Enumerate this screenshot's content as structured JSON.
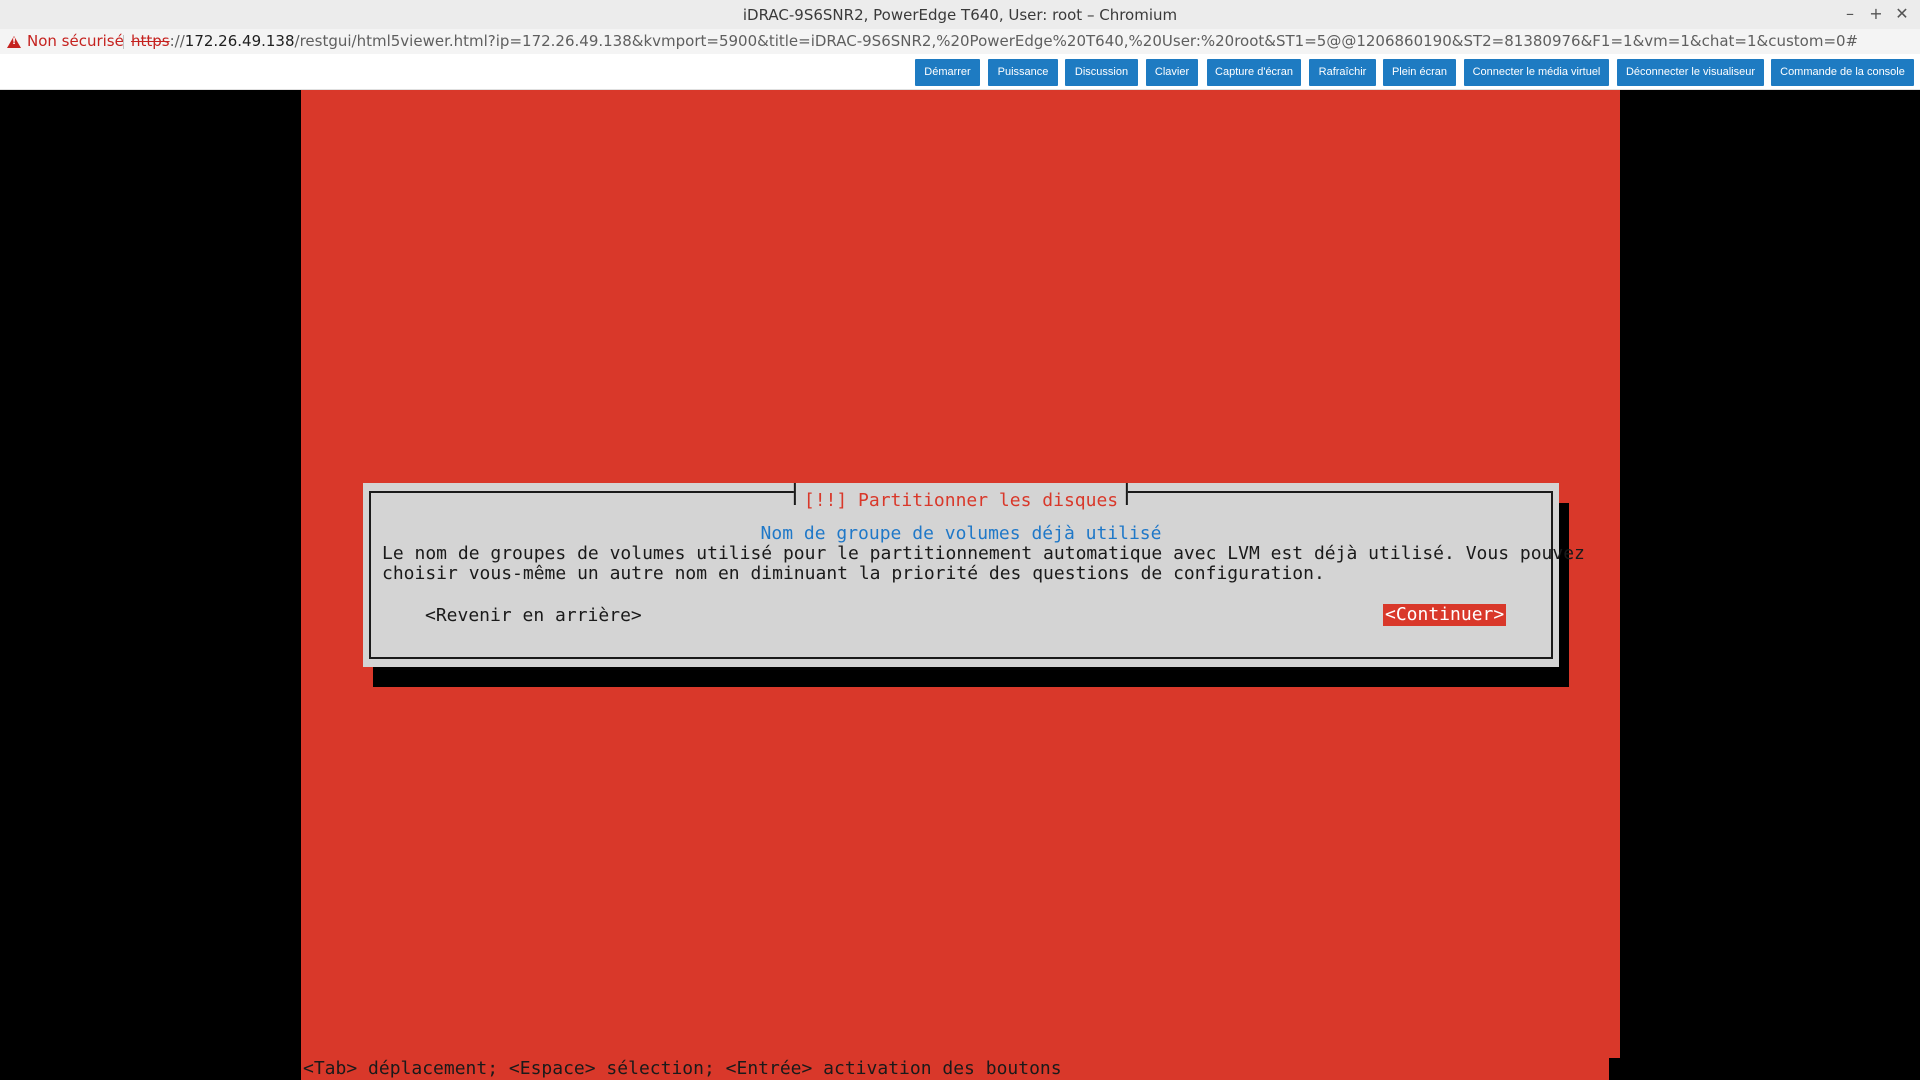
{
  "window": {
    "title": "iDRAC-9S6SNR2, PowerEdge T640, User: root – Chromium",
    "controls": {
      "minimize": "–",
      "maximize": "+",
      "close": "✕"
    }
  },
  "address_bar": {
    "security_icon": "warning-triangle-icon",
    "security_label": "Non sécurisé",
    "url_scheme": "https",
    "url_sep": "://",
    "url_host": "172.26.49.138",
    "url_rest": "/restgui/html5viewer.html?ip=172.26.49.138&kvmport=5900&title=iDRAC-9S6SNR2,%20PowerEdge%20T640,%20User:%20root&ST1=5@@1206860190&ST2=81380976&F1=1&vm=1&chat=1&custom=0#"
  },
  "toolbar": {
    "buttons": [
      "Démarrer",
      "Puissance",
      "Discussion",
      "Clavier",
      "Capture d'écran",
      "Rafraîchir",
      "Plein écran",
      "Connecter le média virtuel",
      "Déconnecter le visualiseur",
      "Commande de la console"
    ],
    "button_color": "#1e7bc2"
  },
  "console": {
    "background_color": "#d9382a",
    "dialog": {
      "title": "[!!] Partitionner les disques",
      "subtitle": "Nom de groupe de volumes déjà utilisé",
      "body_line1": "Le nom de groupes de volumes utilisé pour le partitionnement automatique avec LVM est déjà utilisé. Vous pouvez",
      "body_line2": "choisir vous-même un autre nom en diminuant la priorité des questions de configuration.",
      "back_button": "<Revenir en arrière>",
      "continue_button": "<Continuer>"
    },
    "status_line": "<Tab> déplacement; <Espace> sélection; <Entrée> activation des boutons"
  }
}
